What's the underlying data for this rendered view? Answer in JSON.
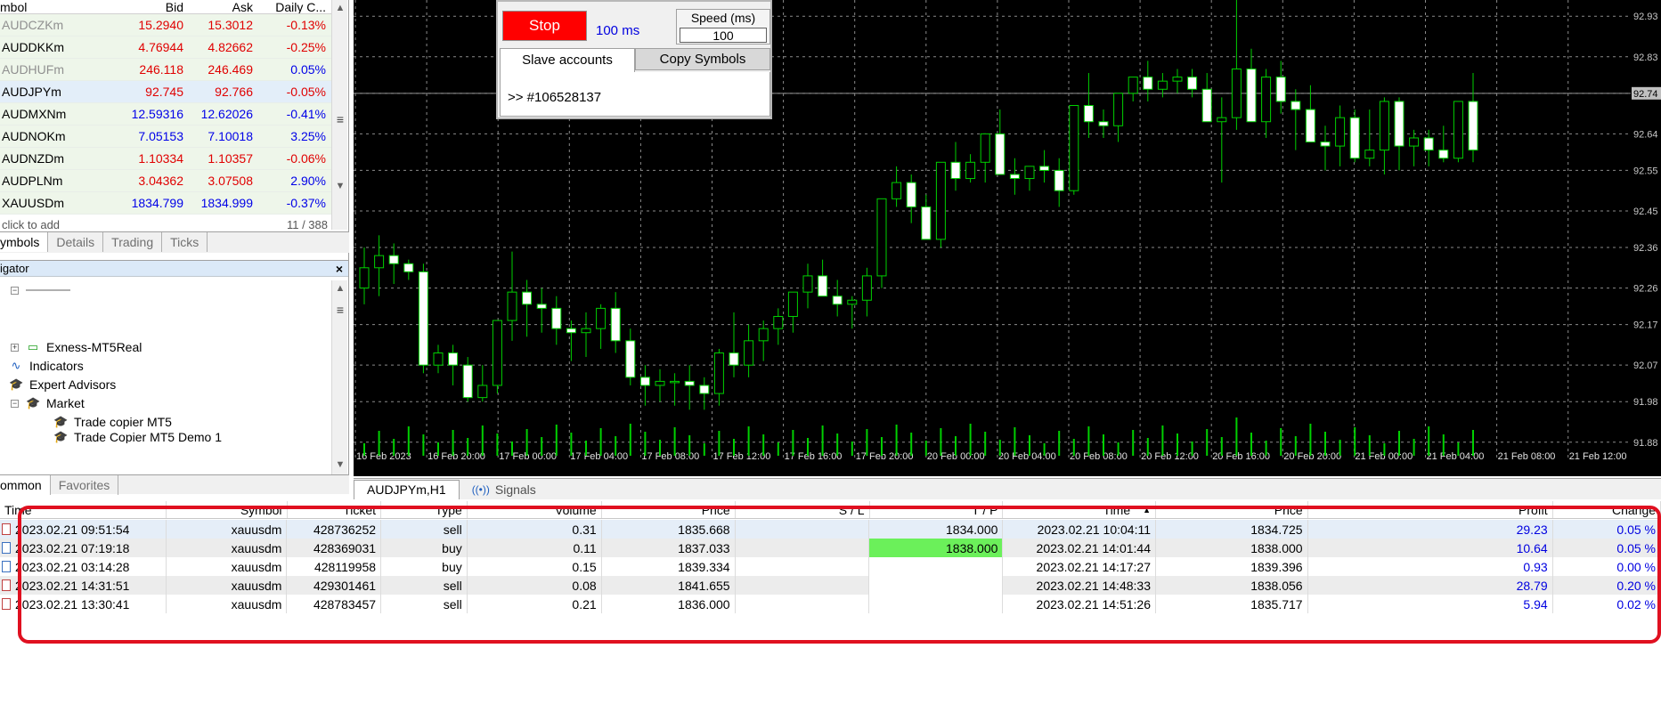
{
  "market_watch": {
    "columns": [
      "mbol",
      "Bid",
      "Ask",
      "Daily C..."
    ],
    "rows": [
      {
        "symbol": "AUDCZKm",
        "bid": "15.2940",
        "ask": "15.3012",
        "change": "-0.13%",
        "color": "red",
        "dim": true
      },
      {
        "symbol": "AUDDKKm",
        "bid": "4.76944",
        "ask": "4.82662",
        "change": "-0.25%",
        "color": "red"
      },
      {
        "symbol": "AUDHUFm",
        "bid": "246.118",
        "ask": "246.469",
        "change": "0.05%",
        "color": "red",
        "dim": true
      },
      {
        "symbol": "AUDJPYm",
        "bid": "92.745",
        "ask": "92.766",
        "change": "-0.05%",
        "color": "red",
        "selected": true
      },
      {
        "symbol": "AUDMXNm",
        "bid": "12.59316",
        "ask": "12.62026",
        "change": "-0.41%",
        "color": "blue"
      },
      {
        "symbol": "AUDNOKm",
        "bid": "7.05153",
        "ask": "7.10018",
        "change": "3.25%",
        "color": "blue"
      },
      {
        "symbol": "AUDNZDm",
        "bid": "1.10334",
        "ask": "1.10357",
        "change": "-0.06%",
        "color": "red"
      },
      {
        "symbol": "AUDPLNm",
        "bid": "3.04362",
        "ask": "3.07508",
        "change": "2.90%",
        "color": "red"
      },
      {
        "symbol": "XAUUSDm",
        "bid": "1834.799",
        "ask": "1834.999",
        "change": "-0.37%",
        "color": "blue"
      }
    ],
    "footer_left": "click to add",
    "footer_right": "11 / 388",
    "tabs": [
      "ymbols",
      "Details",
      "Trading",
      "Ticks"
    ]
  },
  "navigator": {
    "title": "igator",
    "close": "×",
    "items": [
      "Exness-MT5Real",
      "Indicators",
      "Expert Advisors",
      "Market",
      "Trade copier MT5",
      "Trade Copier MT5 Demo 1"
    ],
    "tabs": [
      "ommon",
      "Favorites"
    ]
  },
  "copier": {
    "stop_label": "Stop",
    "speed_display": "100 ms",
    "speed_label": "Speed (ms)",
    "speed_value": "100",
    "tab_slave": "Slave accounts",
    "tab_copy": "Copy Symbols",
    "account": ">> #106528137"
  },
  "chart": {
    "symbol_tab": "AUDJPYm,H1",
    "signals_tab": "Signals",
    "price_labels": [
      "92.93",
      "92.83",
      "92.74",
      "92.64",
      "92.55",
      "92.45",
      "92.36",
      "92.26",
      "92.17",
      "92.07",
      "91.98",
      "91.88"
    ],
    "time_labels": [
      "16 Feb 2023",
      "16 Feb 20:00",
      "17 Feb 00:00",
      "17 Feb 04:00",
      "17 Feb 08:00",
      "17 Feb 12:00",
      "17 Feb 16:00",
      "17 Feb 20:00",
      "20 Feb 00:00",
      "20 Feb 04:00",
      "20 Feb 08:00",
      "20 Feb 12:00",
      "20 Feb 16:00",
      "20 Feb 20:00",
      "21 Feb 00:00",
      "21 Feb 04:00",
      "21 Feb 08:00",
      "21 Feb 12:00"
    ],
    "current_price": "92.74",
    "colors": {
      "bull": "#00d000",
      "bear_body": "#ffffff",
      "grid": "#8a8a8a",
      "background": "#000000"
    }
  },
  "trades": {
    "headers": [
      "Time",
      "Symbol",
      "Ticket",
      "Type",
      "Volume",
      "Price",
      "S / L",
      "T / P",
      "Time",
      "Price",
      "Profit",
      "Change"
    ],
    "rows": [
      {
        "time": "2023.02.21 09:51:54",
        "symbol": "xauusdm",
        "ticket": "428736252",
        "type": "sell",
        "volume": "0.31",
        "price": "1835.668",
        "sl": "",
        "tp": "1834.000",
        "close_time": "2023.02.21 10:04:11",
        "close_price": "1834.725",
        "profit": "29.23",
        "change": "0.05 %"
      },
      {
        "time": "2023.02.21 07:19:18",
        "symbol": "xauusdm",
        "ticket": "428369031",
        "type": "buy",
        "volume": "0.11",
        "price": "1837.033",
        "sl": "",
        "tp": "1838.000",
        "close_time": "2023.02.21 14:01:44",
        "close_price": "1838.000",
        "profit": "10.64",
        "change": "0.05 %"
      },
      {
        "time": "2023.02.21 03:14:28",
        "symbol": "xauusdm",
        "ticket": "428119958",
        "type": "buy",
        "volume": "0.15",
        "price": "1839.334",
        "sl": "",
        "tp": "",
        "close_time": "2023.02.21 14:17:27",
        "close_price": "1839.396",
        "profit": "0.93",
        "change": "0.00 %"
      },
      {
        "time": "2023.02.21 14:31:51",
        "symbol": "xauusdm",
        "ticket": "429301461",
        "type": "sell",
        "volume": "0.08",
        "price": "1841.655",
        "sl": "",
        "tp": "",
        "close_time": "2023.02.21 14:48:33",
        "close_price": "1838.056",
        "profit": "28.79",
        "change": "0.20 %"
      },
      {
        "time": "2023.02.21 13:30:41",
        "symbol": "xauusdm",
        "ticket": "428783457",
        "type": "sell",
        "volume": "0.21",
        "price": "1836.000",
        "sl": "",
        "tp": "",
        "close_time": "2023.02.21 14:51:26",
        "close_price": "1835.717",
        "profit": "5.94",
        "change": "0.02 %"
      }
    ]
  }
}
